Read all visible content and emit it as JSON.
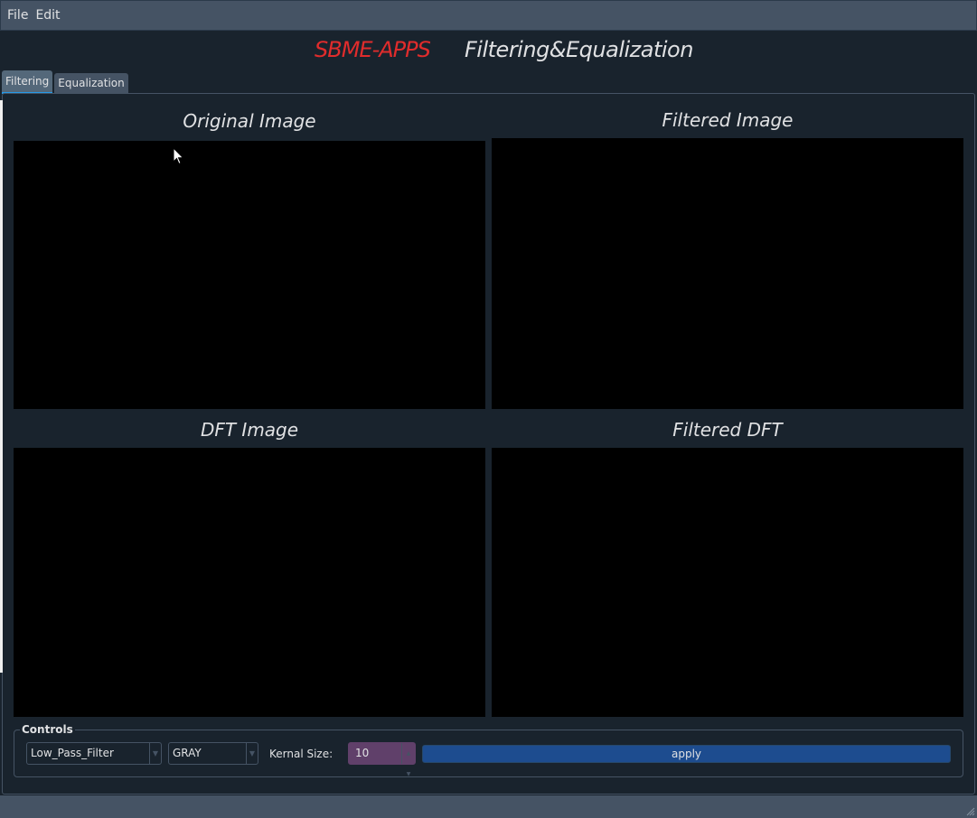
{
  "menu": {
    "file": "File",
    "edit": "Edit"
  },
  "header": {
    "brand": "SBME-APPS",
    "subtitle": "Filtering&Equalization"
  },
  "tabs": [
    {
      "label": "Filtering",
      "active": true
    },
    {
      "label": "Equalization",
      "active": false
    }
  ],
  "views": {
    "original": "Original Image",
    "filtered": "Filtered Image",
    "dft": "DFT Image",
    "filtered_dft": "Filtered DFT"
  },
  "controls": {
    "group_label": "Controls",
    "filter_select": "Low_Pass_Filter",
    "color_select": "GRAY",
    "kernel_label": "Kernal Size:",
    "kernel_value": "10",
    "apply_label": "apply"
  },
  "colors": {
    "brand": "#e02c2c",
    "background": "#19232d",
    "accent": "#259ae9",
    "apply": "#1d4c8f",
    "spinbox": "#60406a"
  }
}
